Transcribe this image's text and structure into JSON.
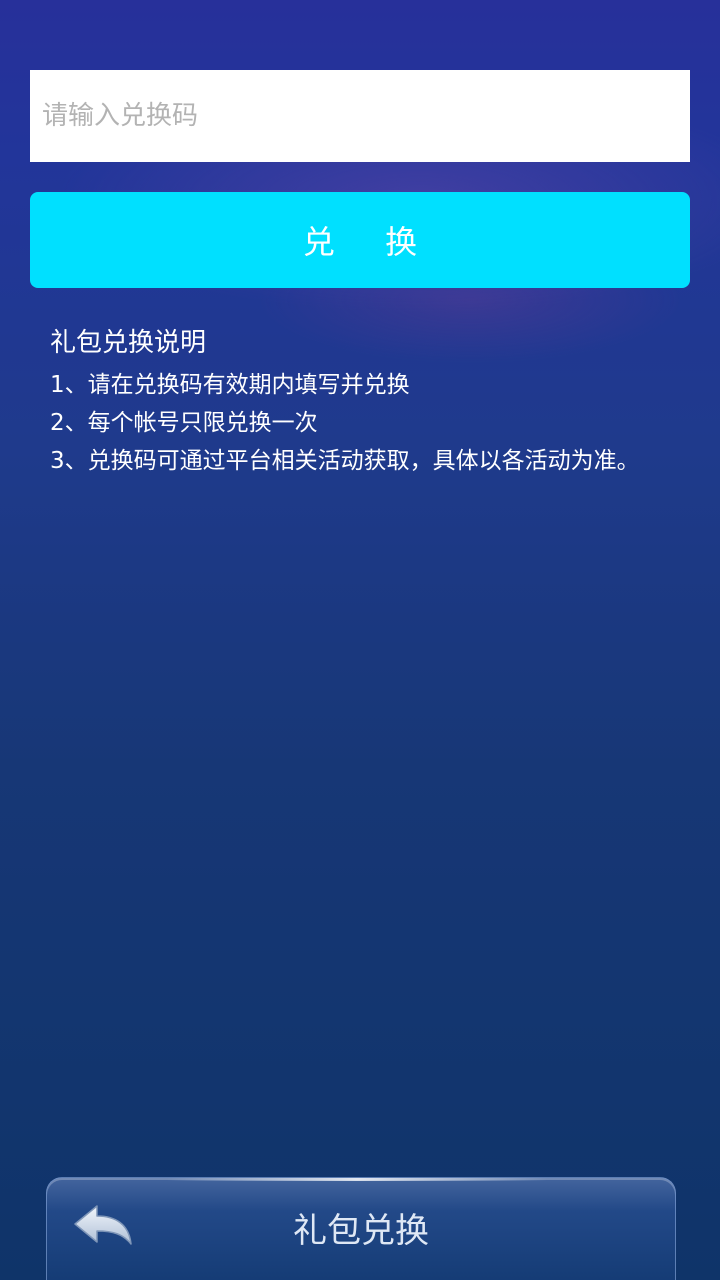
{
  "redeem": {
    "input_placeholder": "请输入兑换码",
    "input_value": "",
    "button_label": "兑 换"
  },
  "instructions": {
    "title": "礼包兑换说明",
    "items": [
      "1、请在兑换码有效期内填写并兑换",
      "2、每个帐号只限兑换一次",
      "3、兑换码可通过平台相关活动获取，具体以各活动为准。"
    ]
  },
  "bottom_bar": {
    "title": "礼包兑换",
    "back_icon": "back-arrow-icon"
  },
  "colors": {
    "accent": "#00e0ff",
    "background_top": "#27309a",
    "background_bottom": "#0f3469"
  }
}
